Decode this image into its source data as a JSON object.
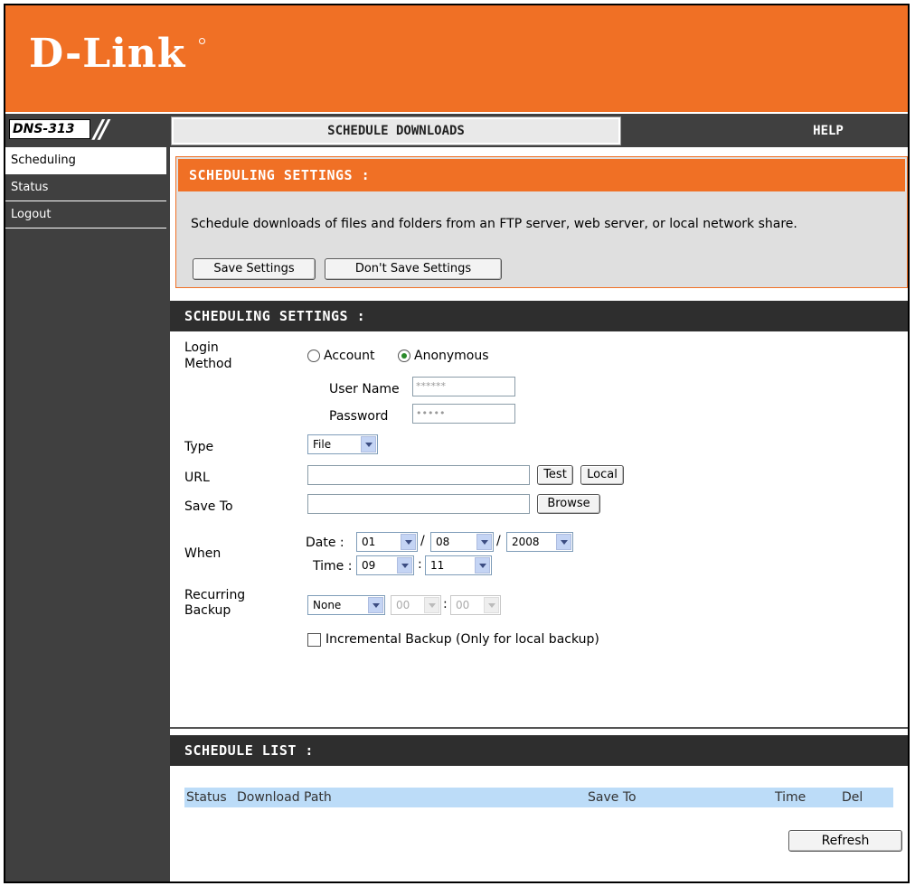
{
  "brand": {
    "logo": "D-Link"
  },
  "model": "DNS-313",
  "nav": {
    "tab_active": "SCHEDULE DOWNLOADS",
    "help": "HELP"
  },
  "sidebar": {
    "items": [
      {
        "label": "Scheduling",
        "active": true
      },
      {
        "label": "Status"
      },
      {
        "label": "Logout"
      }
    ]
  },
  "intro": {
    "title": "SCHEDULING SETTINGS :",
    "text": "Schedule downloads of files and folders from an FTP server, web server, or local network share.",
    "save_label": "Save Settings",
    "dont_save_label": "Don't Save Settings"
  },
  "settings": {
    "title": "SCHEDULING SETTINGS :",
    "login_method_label_1": "Login",
    "login_method_label_2": "Method",
    "account_label": "Account",
    "anonymous_label": "Anonymous",
    "selected_method": "Anonymous",
    "username_label": "User Name",
    "username_value": "******",
    "password_label": "Password",
    "password_value": "•••••",
    "type_label": "Type",
    "type_value": "File",
    "url_label": "URL",
    "url_value": "",
    "test_label": "Test",
    "local_label": "Local",
    "saveto_label": "Save To",
    "saveto_value": "",
    "browse_label": "Browse",
    "when_label": "When",
    "date_label": "Date :",
    "date_month": "01",
    "date_day": "08",
    "date_year": "2008",
    "sep_slash": "/",
    "time_label": "Time :",
    "time_hour": "09",
    "time_minute": "11",
    "sep_colon": ":",
    "recurring_label_1": "Recurring",
    "recurring_label_2": "Backup",
    "recurring_value": "None",
    "recurring_hour": "00",
    "recurring_minute": "00",
    "incremental_label": "Incremental Backup (Only for local backup)",
    "incremental_checked": false
  },
  "schedule_list": {
    "title": "SCHEDULE LIST :",
    "columns": [
      "Status",
      "Download Path",
      "Save To",
      "Time",
      "Del"
    ],
    "rows": [],
    "refresh_label": "Refresh"
  }
}
